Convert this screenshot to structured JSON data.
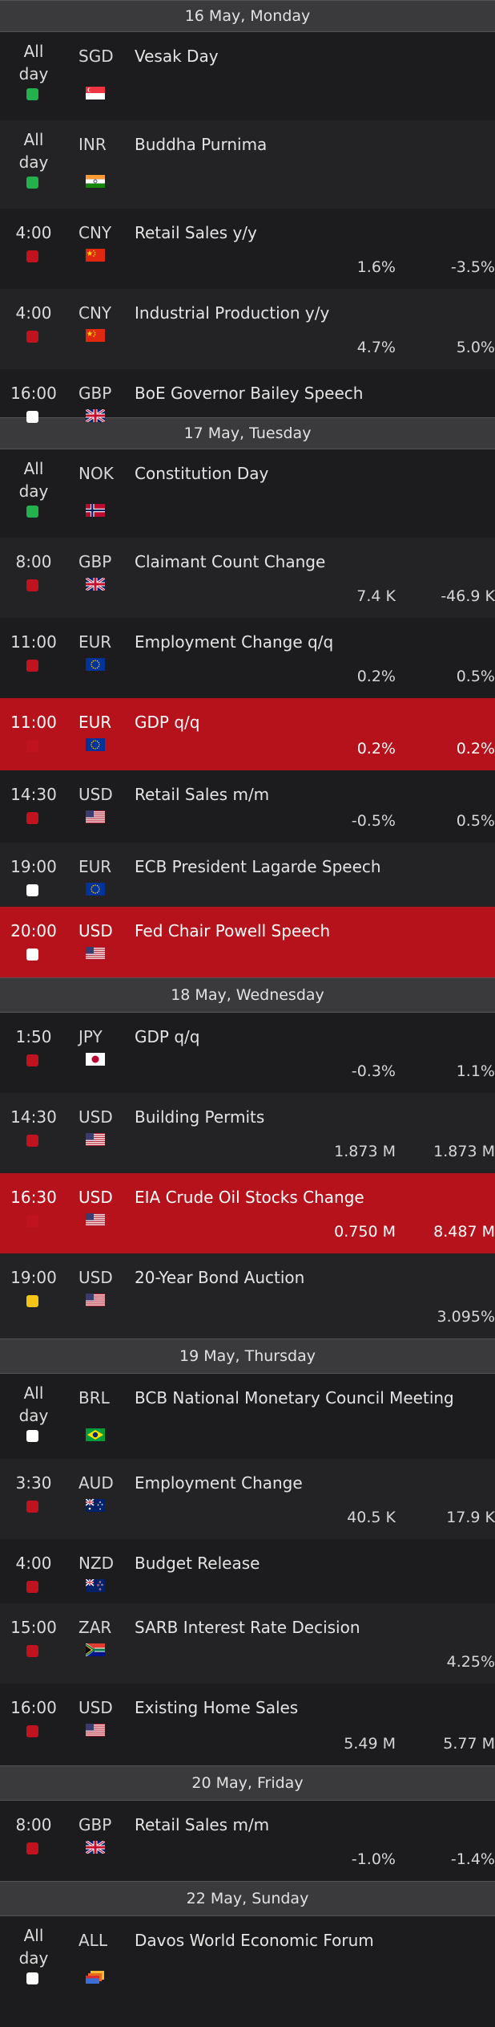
{
  "colors": {
    "background": "#1c1c1e",
    "header_bg": "#3a3a3c",
    "highlight_red": "#b5121b",
    "importance_high": "#c1121f",
    "importance_holiday": "#22b14c",
    "importance_medium": "#f5c518",
    "importance_low": "#ffffff"
  },
  "calendar": [
    {
      "date": "16 May, Monday",
      "events": [
        {
          "time": "All day",
          "currency": "SGD",
          "flag": "flag-sg-icon",
          "importance": "holiday",
          "title": "Vesak Day",
          "values": []
        },
        {
          "time": "All day",
          "currency": "INR",
          "flag": "flag-in-icon",
          "importance": "holiday",
          "title": "Buddha Purnima",
          "values": []
        },
        {
          "time": "4:00",
          "currency": "CNY",
          "flag": "flag-cn-icon",
          "importance": "high",
          "title": "Retail Sales y/y",
          "values": [
            "1.6%",
            "-3.5%"
          ]
        },
        {
          "time": "4:00",
          "currency": "CNY",
          "flag": "flag-cn-icon",
          "importance": "high",
          "title": "Industrial Production y/y",
          "values": [
            "4.7%",
            "5.0%"
          ]
        },
        {
          "time": "16:00",
          "currency": "GBP",
          "flag": "flag-uk-icon",
          "importance": "low",
          "title": "BoE Governor Bailey Speech",
          "values": []
        }
      ]
    },
    {
      "date": "17 May, Tuesday",
      "events": [
        {
          "time": "All day",
          "currency": "NOK",
          "flag": "flag-no-icon",
          "importance": "holiday",
          "title": "Constitution Day",
          "values": []
        },
        {
          "time": "8:00",
          "currency": "GBP",
          "flag": "flag-uk-icon",
          "importance": "high",
          "title": "Claimant Count Change",
          "values": [
            "7.4 K",
            "-46.9 K"
          ]
        },
        {
          "time": "11:00",
          "currency": "EUR",
          "flag": "flag-eu-icon",
          "importance": "high",
          "title": "Employment Change q/q",
          "values": [
            "0.2%",
            "0.5%"
          ]
        },
        {
          "time": "11:00",
          "currency": "EUR",
          "flag": "flag-eu-icon",
          "importance": "high",
          "title": "GDP q/q",
          "values": [
            "0.2%",
            "0.2%"
          ],
          "highlight": true
        },
        {
          "time": "14:30",
          "currency": "USD",
          "flag": "flag-us-icon",
          "importance": "high",
          "title": "Retail Sales m/m",
          "values": [
            "-0.5%",
            "0.5%"
          ]
        },
        {
          "time": "19:00",
          "currency": "EUR",
          "flag": "flag-eu-icon",
          "importance": "low",
          "title": "ECB President Lagarde Speech",
          "values": []
        },
        {
          "time": "20:00",
          "currency": "USD",
          "flag": "flag-us-icon",
          "importance": "low",
          "title": "Fed Chair Powell Speech",
          "values": [],
          "highlight": true
        }
      ]
    },
    {
      "date": "18 May, Wednesday",
      "events": [
        {
          "time": "1:50",
          "currency": "JPY",
          "flag": "flag-jp-icon",
          "importance": "high",
          "title": "GDP q/q",
          "values": [
            "-0.3%",
            "1.1%"
          ]
        },
        {
          "time": "14:30",
          "currency": "USD",
          "flag": "flag-us-icon",
          "importance": "high",
          "title": "Building Permits",
          "values": [
            "1.873 M",
            "1.873 M"
          ]
        },
        {
          "time": "16:30",
          "currency": "USD",
          "flag": "flag-us-icon",
          "importance": "high",
          "title": "EIA Crude Oil Stocks Change",
          "values": [
            "0.750 M",
            "8.487 M"
          ],
          "highlight": true
        },
        {
          "time": "19:00",
          "currency": "USD",
          "flag": "flag-us-icon",
          "importance": "medium",
          "title": "20-Year Bond Auction",
          "values": [
            "",
            "3.095%"
          ]
        }
      ]
    },
    {
      "date": "19 May, Thursday",
      "events": [
        {
          "time": "All day",
          "currency": "BRL",
          "flag": "flag-br-icon",
          "importance": "low",
          "title": "BCB National Monetary Council Meeting",
          "values": []
        },
        {
          "time": "3:30",
          "currency": "AUD",
          "flag": "flag-au-icon",
          "importance": "high",
          "title": "Employment Change",
          "values": [
            "40.5 K",
            "17.9 K"
          ]
        },
        {
          "time": "4:00",
          "currency": "NZD",
          "flag": "flag-nz-icon",
          "importance": "high",
          "title": "Budget Release",
          "values": []
        },
        {
          "time": "15:00",
          "currency": "ZAR",
          "flag": "flag-za-icon",
          "importance": "high",
          "title": "SARB Interest Rate Decision",
          "values": [
            "",
            "4.25%"
          ]
        },
        {
          "time": "16:00",
          "currency": "USD",
          "flag": "flag-us-icon",
          "importance": "high",
          "title": "Existing Home Sales",
          "values": [
            "5.49 M",
            "5.77 M"
          ]
        }
      ]
    },
    {
      "date": "20 May, Friday",
      "events": [
        {
          "time": "8:00",
          "currency": "GBP",
          "flag": "flag-uk-icon",
          "importance": "high",
          "title": "Retail Sales m/m",
          "values": [
            "-1.0%",
            "-1.4%"
          ]
        }
      ]
    },
    {
      "date": "22 May, Sunday",
      "events": [
        {
          "time": "All day",
          "currency": "ALL",
          "flag": "flag-all-icon",
          "importance": "low",
          "title": "Davos World Economic Forum",
          "values": []
        }
      ]
    }
  ]
}
